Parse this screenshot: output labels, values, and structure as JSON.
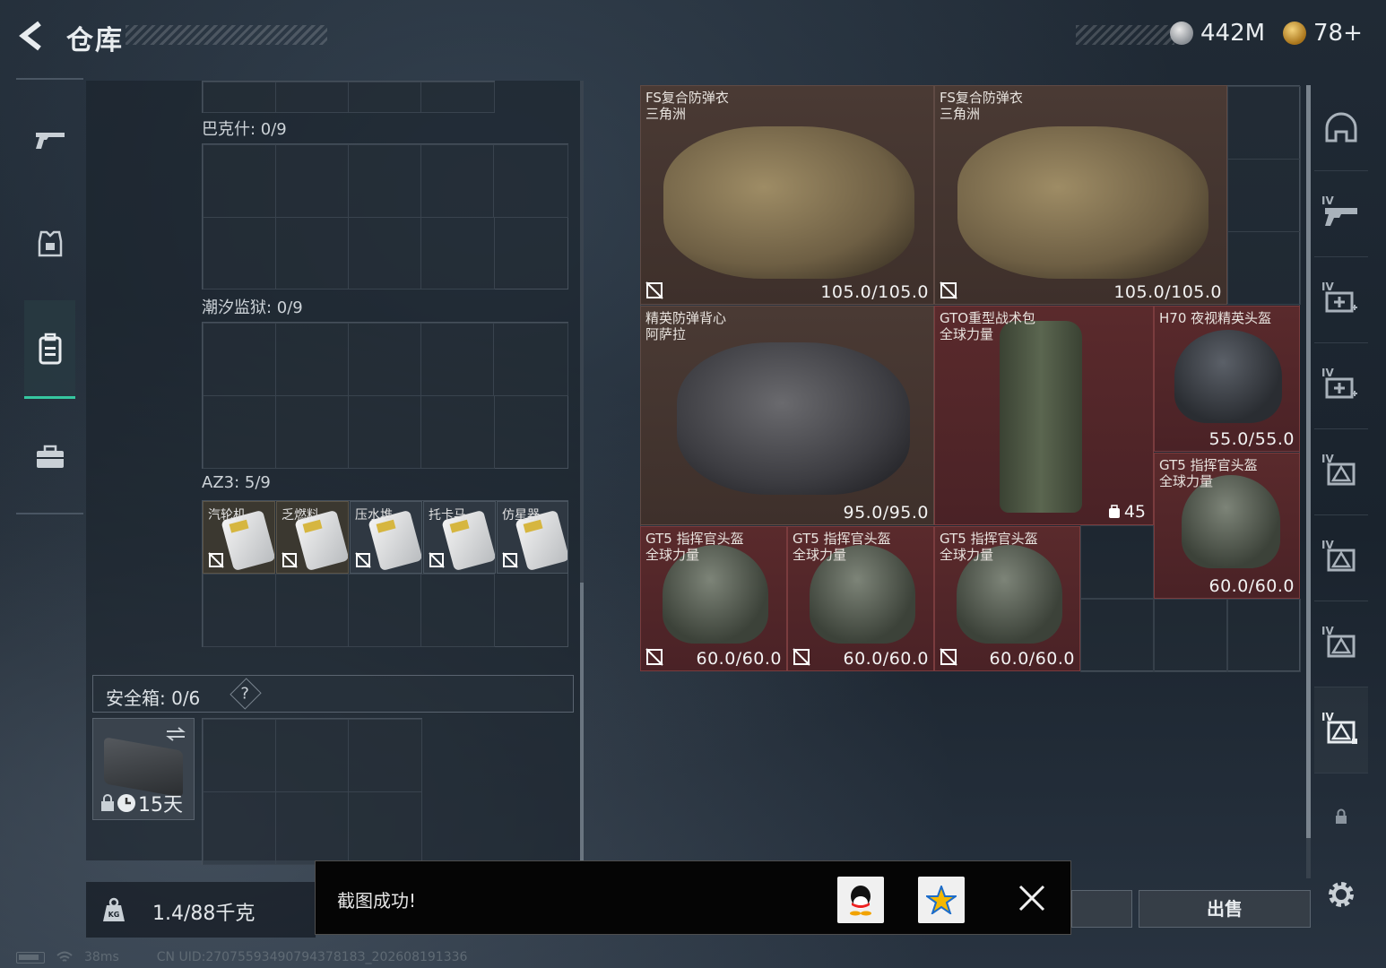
{
  "header": {
    "title": "仓库",
    "currency": [
      {
        "icon": "silver-coin-icon",
        "value": "442M"
      },
      {
        "icon": "gold-coin-icon",
        "value": "78+"
      }
    ]
  },
  "left_nav": [
    {
      "icon": "gun-icon",
      "active": false
    },
    {
      "icon": "armor-icon",
      "active": false
    },
    {
      "icon": "backpack-icon",
      "active": true
    },
    {
      "icon": "briefcase-icon",
      "active": false
    }
  ],
  "containers": [
    {
      "label": "巴克什: 0/9"
    },
    {
      "label": "潮汐监狱: 0/9"
    },
    {
      "label": "AZ3: 5/9",
      "items": [
        "汽轮机",
        "乏燃料",
        "压水堆",
        "托卡马",
        "仿星器"
      ]
    }
  ],
  "safe": {
    "label": "安全箱: 0/6",
    "help": "?",
    "days": "15天"
  },
  "weight": {
    "kg_label": "KG",
    "value": "1.4/88千克"
  },
  "stash": {
    "items": [
      {
        "name": "FS复合防弹衣\n三角洲",
        "durability": "105.0/105.0"
      },
      {
        "name": "FS复合防弹衣\n三角洲",
        "durability": "105.0/105.0"
      },
      {
        "name": "精英防弹背心\n阿萨拉",
        "durability": "95.0/95.0"
      },
      {
        "name": "GTO重型战术包\n全球力量",
        "level": "45"
      },
      {
        "name": "H70 夜视精英头盔",
        "durability": "55.0/55.0"
      },
      {
        "name": "GT5 指挥官头盔\n全球力量",
        "durability": "60.0/60.0"
      },
      {
        "name": "GT5 指挥官头盔\n全球力量",
        "durability": "60.0/60.0"
      },
      {
        "name": "GT5 指挥官头盔\n全球力量",
        "durability": "60.0/60.0"
      },
      {
        "name": "GT5 指挥官头盔\n全球力量",
        "durability": "60.0/60.0"
      }
    ]
  },
  "right_nav": [
    {
      "icon": "helmet-slot-icon",
      "lv": ""
    },
    {
      "icon": "gun-slot-icon",
      "lv": "IV"
    },
    {
      "icon": "medkit-slot-icon",
      "lv": "IV"
    },
    {
      "icon": "medkit-slot-icon",
      "lv": "IV"
    },
    {
      "icon": "key-slot-icon",
      "lv": "IV"
    },
    {
      "icon": "key-slot-icon",
      "lv": "IV"
    },
    {
      "icon": "key-slot-icon",
      "lv": "IV"
    },
    {
      "icon": "key-slot-icon",
      "lv": "IV"
    },
    {
      "icon": "lock-icon",
      "lv": ""
    }
  ],
  "actions": {
    "sell": "出售"
  },
  "toast": {
    "message": "截图成功!"
  },
  "status": {
    "ping": "38ms",
    "uid": "CN UID:2707559349079437818З_202608191336"
  }
}
